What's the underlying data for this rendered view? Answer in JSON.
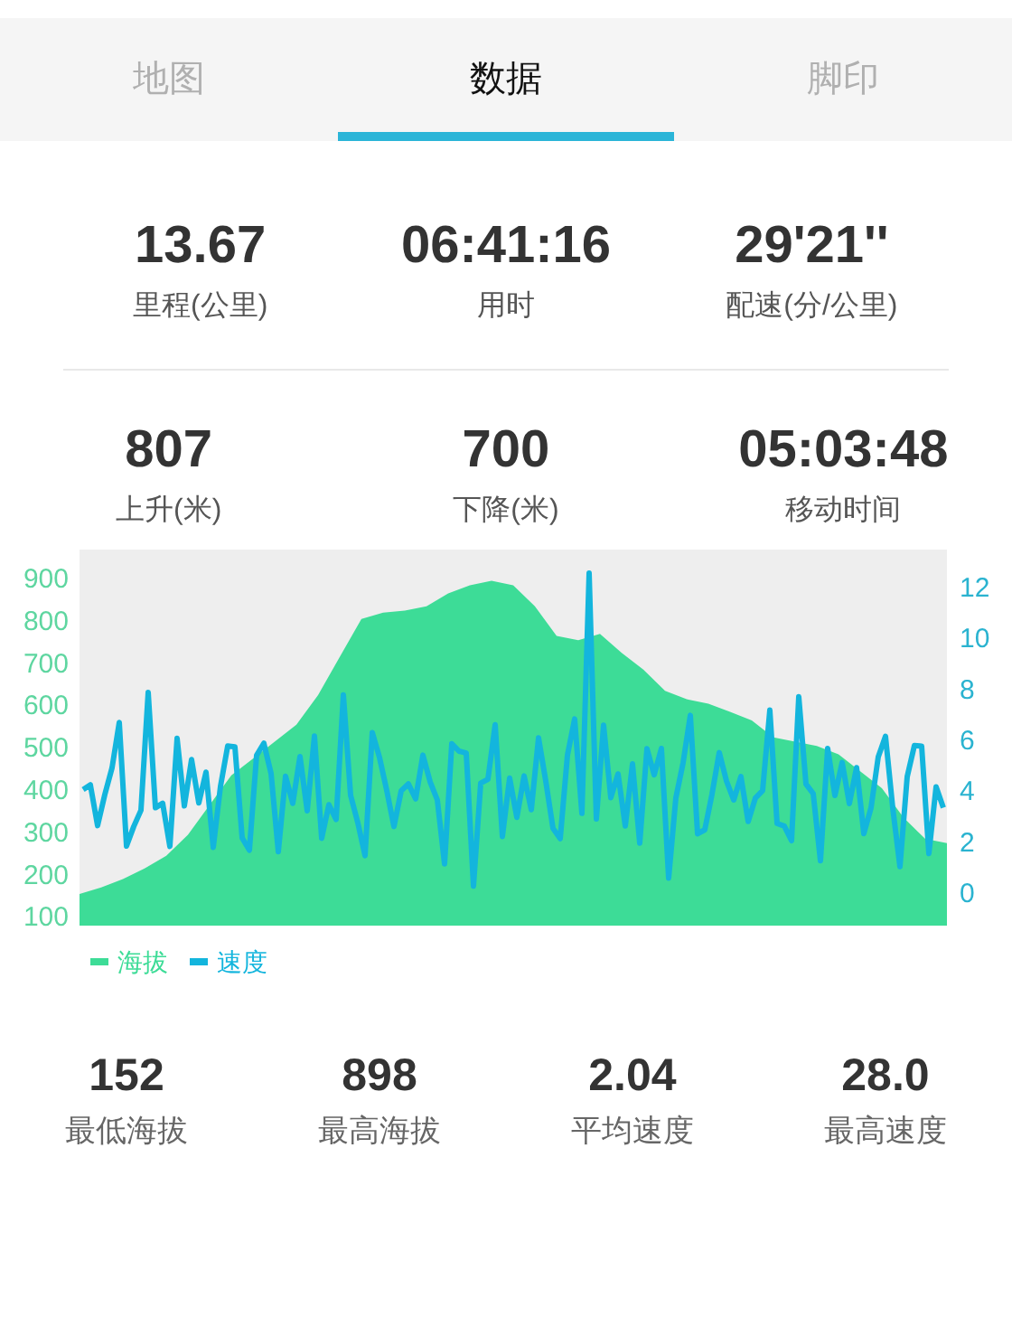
{
  "tabs": [
    {
      "label": "地图",
      "selected": false
    },
    {
      "label": "数据",
      "selected": true
    },
    {
      "label": "脚印",
      "selected": false
    }
  ],
  "stats": [
    {
      "value": "13.67",
      "label": "里程(公里)"
    },
    {
      "value": "06:41:16",
      "label": "用时"
    },
    {
      "value": "29'21''",
      "label": "配速(分/公里)"
    },
    {
      "value": "807",
      "label": "上升(米)"
    },
    {
      "value": "700",
      "label": "下降(米)"
    },
    {
      "value": "05:03:48",
      "label": "移动时间"
    }
  ],
  "chart": {
    "chart_data": {
      "type": "area",
      "ylim": [
        75,
        964
      ],
      "yticks": [
        100,
        200,
        300,
        400,
        500,
        600,
        700,
        800,
        900
      ],
      "series": [
        {
          "name": "海拔",
          "color": "#3ddc97",
          "values": [
            150,
            165,
            185,
            210,
            240,
            290,
            360,
            430,
            470,
            510,
            550,
            620,
            710,
            800,
            815,
            820,
            830,
            860,
            880,
            890,
            880,
            830,
            760,
            750,
            765,
            720,
            680,
            630,
            610,
            600,
            580,
            560,
            520,
            510,
            500,
            480,
            440,
            400,
            330,
            280,
            270
          ]
        }
      ]
    },
    "speed_legend": {
      "name": "速度",
      "color": "#13b5dd"
    },
    "right_axis_ticks": [
      "12",
      "10",
      "8",
      "6",
      "4",
      "2",
      "0"
    ]
  },
  "summary": [
    {
      "value": "152",
      "label": "最低海拔"
    },
    {
      "value": "898",
      "label": "最高海拔"
    },
    {
      "value": "2.04",
      "label": "平均速度"
    },
    {
      "value": "28.0",
      "label": "最高速度"
    }
  ]
}
